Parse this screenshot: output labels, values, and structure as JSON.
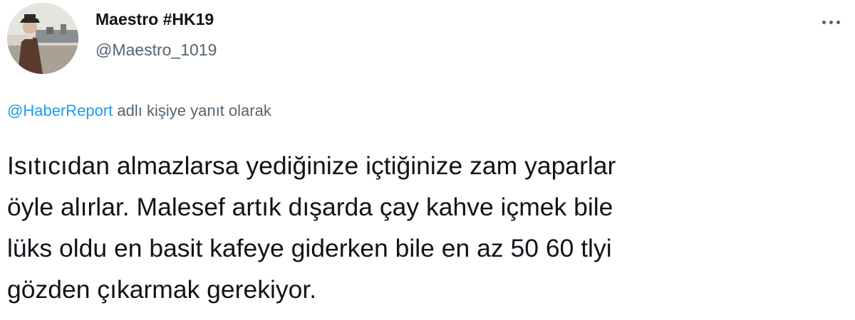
{
  "author": {
    "display_name": "Maestro #HK19",
    "handle": "@Maestro_1019",
    "avatar_icon": "profile-photo"
  },
  "more_icon": "more-horizontal-icon",
  "reply_context": {
    "mention": "@HaberReport",
    "suffix": " adlı kişiye yanıt olarak"
  },
  "tweet": {
    "lines": [
      "Isıtıcıdan almazlarsa yediğinize içtiğinize zam yaparlar",
      "öyle alırlar. Malesef artık dışarda çay kahve içmek bile",
      "lüks oldu en basit kafeye giderken bile en az 50 60 tlyi",
      "gözden çıkarmak gerekiyor."
    ]
  },
  "colors": {
    "text_primary": "#0f1419",
    "text_secondary": "#536471",
    "accent": "#1d9bf0"
  }
}
